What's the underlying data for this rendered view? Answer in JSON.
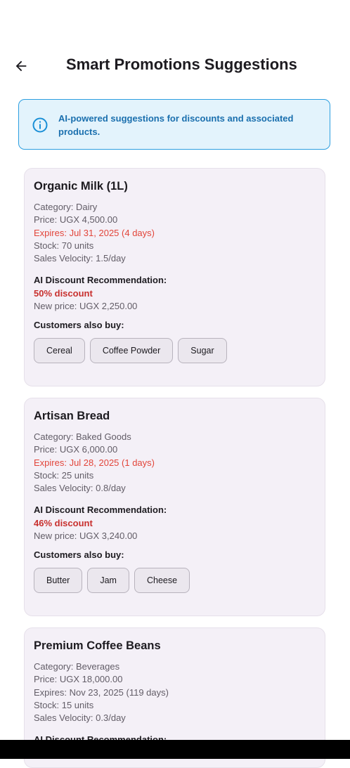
{
  "appbar": {
    "title": "Smart Promotions Suggestions",
    "back_icon": "arrow-back-icon"
  },
  "info": {
    "icon": "info-circle-icon",
    "text": "AI-powered suggestions for discounts and associated products."
  },
  "labels": {
    "ai_recommendation": "AI Discount Recommendation:",
    "customers_also_buy": "Customers also buy:"
  },
  "colors": {
    "accent_blue": "#2d9fe0",
    "expiry_urgent": "#e2453a",
    "discount_red": "#c8302e",
    "card_bg": "#f4f0f7"
  },
  "products": [
    {
      "name": "Organic Milk (1L)",
      "category": "Category: Dairy",
      "price": "Price: UGX 4,500.00",
      "expires": "Expires: Jul 31, 2025 (4 days)",
      "expires_urgent": true,
      "stock": "Stock: 70 units",
      "velocity": "Sales Velocity: 1.5/day",
      "discount": "50% discount",
      "new_price": "New price: UGX 2,250.00",
      "also_buy": [
        "Cereal",
        "Coffee Powder",
        "Sugar"
      ]
    },
    {
      "name": "Artisan Bread",
      "category": "Category: Baked Goods",
      "price": "Price: UGX 6,000.00",
      "expires": "Expires: Jul 28, 2025 (1 days)",
      "expires_urgent": true,
      "stock": "Stock: 25 units",
      "velocity": "Sales Velocity: 0.8/day",
      "discount": "46% discount",
      "new_price": "New price: UGX 3,240.00",
      "also_buy": [
        "Butter",
        "Jam",
        "Cheese"
      ]
    },
    {
      "name": "Premium Coffee Beans",
      "category": "Category: Beverages",
      "price": "Price: UGX 18,000.00",
      "expires": "Expires: Nov 23, 2025 (119 days)",
      "expires_urgent": false,
      "stock": "Stock: 15 units",
      "velocity": "Sales Velocity: 0.3/day"
    }
  ]
}
